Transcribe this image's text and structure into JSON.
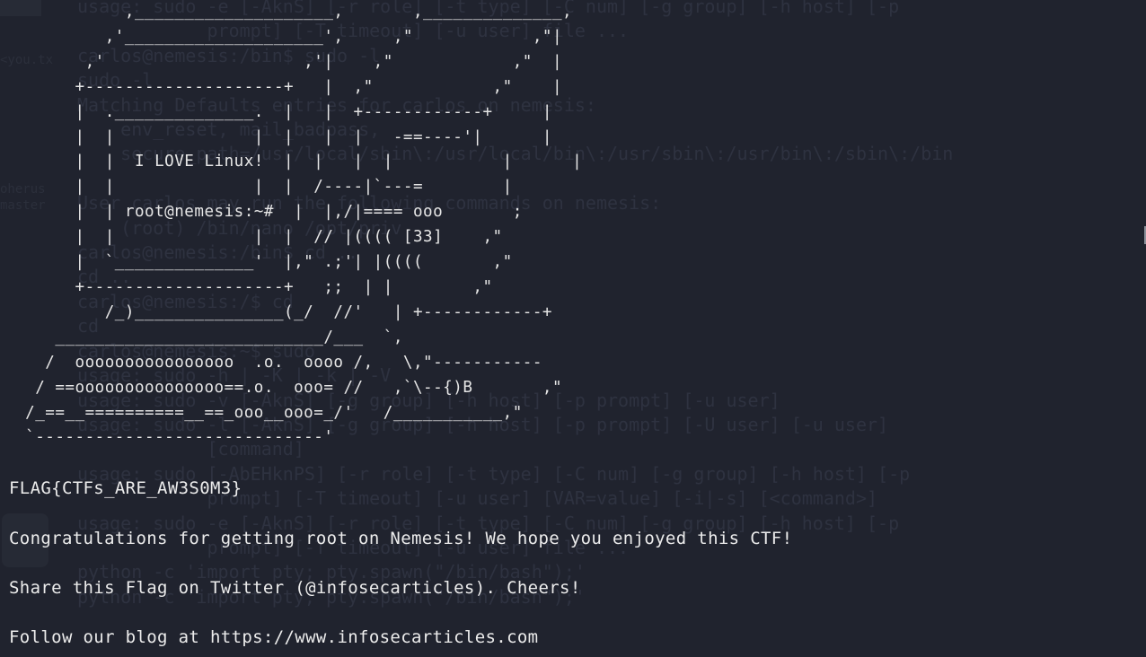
{
  "terminal": {
    "ascii_art": "            ,____________________,       ,______________,\n          ,'____________________',     ,\"            ,\"|\n        ,'                    ,'|    ,\"            ,\"  |\n       +--------------------+   |  ,\"            ,\"    |\n       |  .______________.  |   |  +------------+     |\n       |  |              |  |   |  |   -==----'|      |\n       |  |  I LOVE Linux!  |  |   |  |           |      |\n       |  |              |  |  /----|`---=        |\n       |  | root@nemesis:~#  |  |,/|==== ooo       ;\n       |  |              |  |  // |(((( [33]    ,\"\n       |  `______________'  |,\" .;'| |((((       ,\"\n       +--------------------+   ;;  | |        ,\"\n          /_)_______________(_/  //'   | +------------+\n     ___________________________/___  `,\n    /  oooooooooooooooo  .o.  oooo /,   \\,\"-----------\n   / ==ooooooooooooooo==.o.  ooo= //   ,`\\--{)B       ,\"\n  /_==__==========__==_ooo__ooo=_/'   /___________,\"\n  `-----------------------------'",
    "flag": "FLAG{CTFs_ARE_AW3S0M3}",
    "congrats": "Congratulations for getting root on Nemesis! We hope you enjoyed this CTF!",
    "share": "Share this Flag on Twitter (@infosecarticles). Cheers!",
    "follow": "Follow our blog at https://www.infosecarticles.com"
  },
  "colors": {
    "background": "#20232e",
    "foreground": "#ececec",
    "ghost_text": "#2e3240"
  }
}
